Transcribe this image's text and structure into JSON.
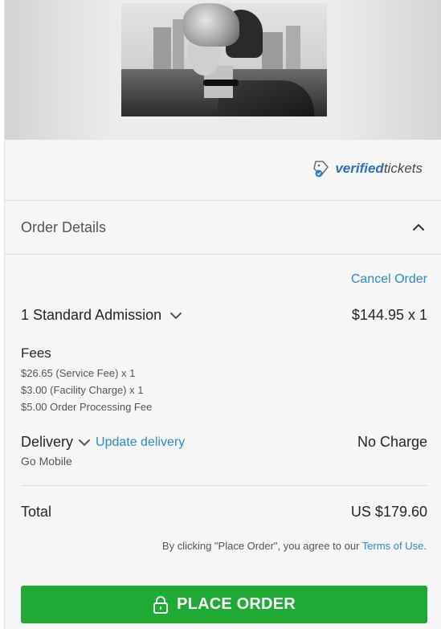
{
  "brand": {
    "verified_a": "verified",
    "verified_b": "tickets",
    "accent": "#2a8dc4",
    "button_color": "#1eaa35"
  },
  "order": {
    "title": "Order Details",
    "cancel": "Cancel Order",
    "ticket_label": "1 Standard Admission",
    "ticket_price": "$144.95 x 1",
    "fees_title": "Fees",
    "fees": [
      "$26.65 (Service Fee) x 1",
      "$3.00 (Facility Charge) x 1",
      "$5.00 Order Processing Fee"
    ],
    "delivery_label": "Delivery",
    "delivery_link": "Update delivery",
    "delivery_value": "No Charge",
    "delivery_method": "Go Mobile",
    "total_label": "Total",
    "total_value": "US $179.60",
    "terms_prefix": "By clicking \"Place Order\", you agree to our ",
    "terms_link": "Terms of Use",
    "terms_suffix": ".",
    "place_order": "PLACE ORDER"
  },
  "icons": {
    "collapse": "chevron-up-icon",
    "ticket_dropdown": "chevron-down-icon",
    "delivery_dropdown": "chevron-down-icon",
    "lock": "lock-icon",
    "verified": "ticket-check-icon"
  }
}
